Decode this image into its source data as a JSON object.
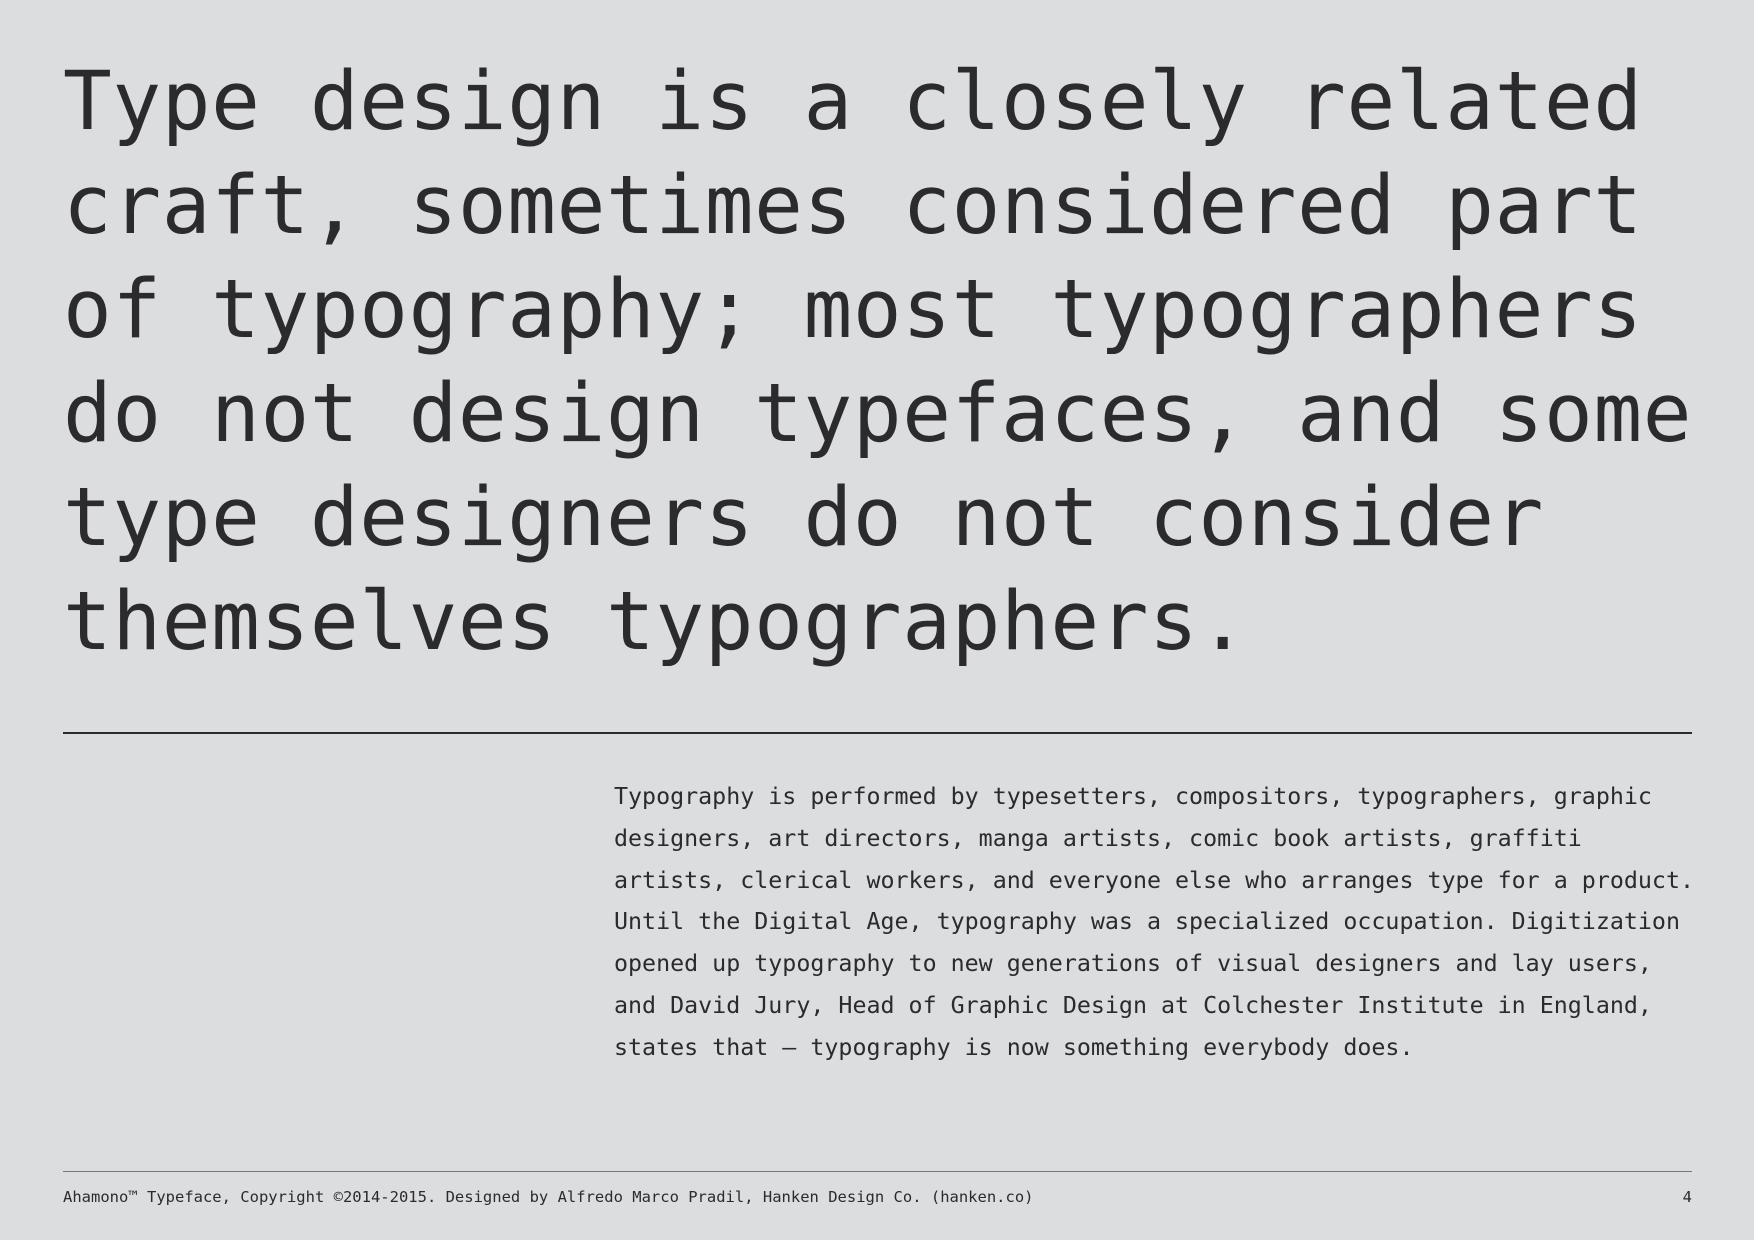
{
  "headline": "Type design is a closely related craft, sometimes considered part of typography; most typographers do not design typefaces, and some type designers do not consider themselves typographers.",
  "body": "Typography is performed by typesetters, compositors, typographers, graphic designers, art directors, manga artists, comic book artists, graffiti artists, clerical workers, and everyone else who arranges type for a product. Until the Digital Age, typography was a specialized occupation. Digitization opened up typography to new generations of visual designers and lay users, and David Jury, Head of Graphic Design at Colchester Institute in England, states that — typography is now something everybody does.",
  "footer": {
    "credit": "Ahamono™ Typeface, Copyright ©2014-2015. Designed by Alfredo Marco Pradil, Hanken Design Co. (hanken.co)",
    "page_number": "4"
  },
  "colors": {
    "background": "#dcdddf",
    "text": "#2b2b2d"
  }
}
